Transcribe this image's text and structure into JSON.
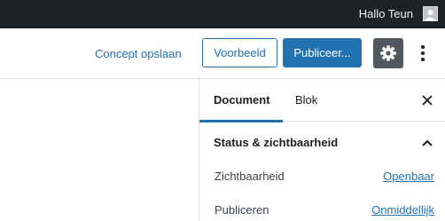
{
  "adminbar": {
    "greeting": "Hallo Teun",
    "avatar_icon": "user-avatar-icon"
  },
  "header": {
    "save_draft_label": "Concept opslaan",
    "preview_label": "Voorbeeld",
    "publish_label": "Publiceer...",
    "settings_icon": "gear-icon",
    "more_icon": "more-vertical-icon"
  },
  "sidebar": {
    "tabs": [
      {
        "label": "Document",
        "active": true
      },
      {
        "label": "Blok",
        "active": false
      }
    ],
    "close_icon": "close-icon",
    "panel": {
      "title": "Status & zichtbaarheid",
      "toggle_icon": "chevron-up-icon",
      "rows": [
        {
          "label": "Zichtbaarheid",
          "value": "Openbaar"
        },
        {
          "label": "Publiceren",
          "value": "Onmiddellijk"
        }
      ]
    }
  },
  "colors": {
    "accent": "#2271b1",
    "adminbar": "#1d2327",
    "settings_button": "#50575e"
  }
}
